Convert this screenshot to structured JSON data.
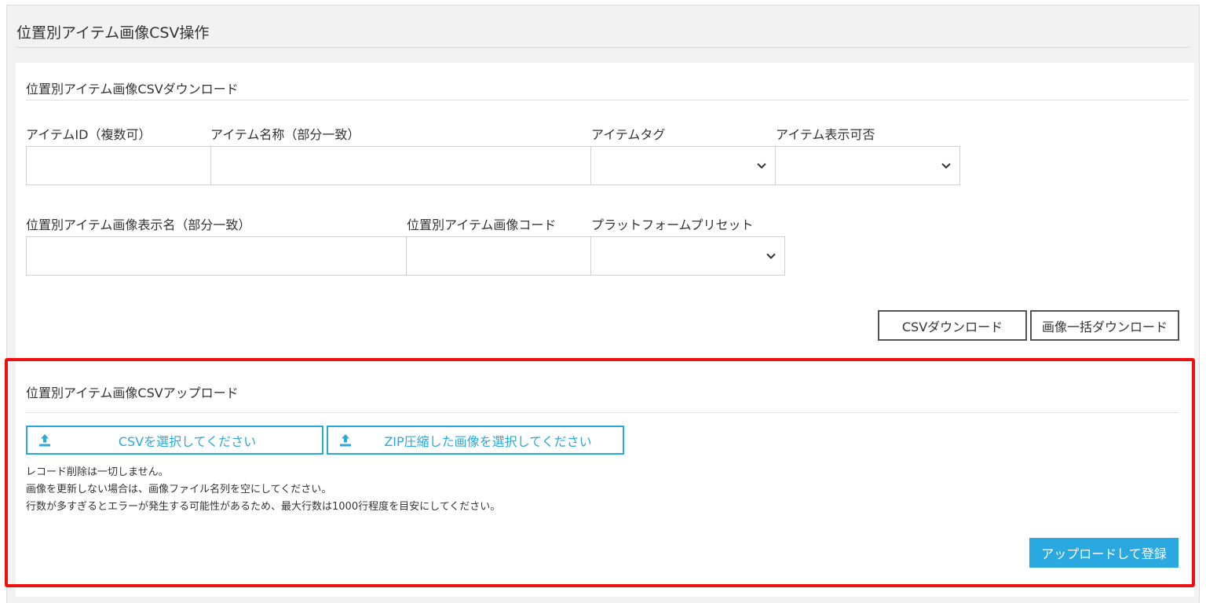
{
  "page_title": "位置別アイテム画像CSV操作",
  "download": {
    "section_title": "位置別アイテム画像CSVダウンロード",
    "fields": {
      "item_id_label": "アイテムID（複数可）",
      "item_name_label": "アイテム名称（部分一致）",
      "item_tag_label": "アイテムタグ",
      "item_visibility_label": "アイテム表示可否",
      "image_display_name_label": "位置別アイテム画像表示名（部分一致）",
      "image_code_label": "位置別アイテム画像コード",
      "platform_preset_label": "プラットフォームプリセット"
    },
    "csv_download_button": "CSVダウンロード",
    "image_bulk_download_button": "画像一括ダウンロード"
  },
  "upload": {
    "section_title": "位置別アイテム画像CSVアップロード",
    "select_csv_button": "CSVを選択してください",
    "select_zip_button": "ZIP圧縮した画像を選択してください",
    "notes": [
      "レコード削除は一切しません。",
      "画像を更新しない場合は、画像ファイル名列を空にしてください。",
      "行数が多すぎるとエラーが発生する可能性があるため、最大行数は1000行程度を目安にしてください。"
    ],
    "submit_button": "アップロードして登録"
  },
  "colors": {
    "accent": "#2aa8e0",
    "highlight": "#ee1111"
  },
  "icons": {
    "select_chevron": "chevron-down-icon",
    "upload": "upload-icon"
  }
}
